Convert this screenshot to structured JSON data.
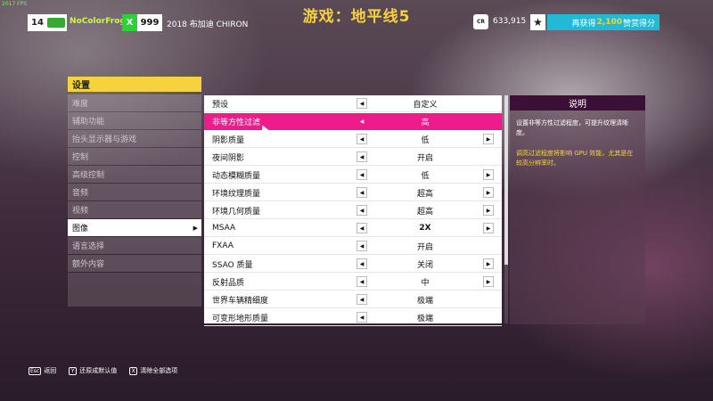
{
  "fps_text": "2017 FPS",
  "top": {
    "level": "14",
    "player_name": "NoColorFrog",
    "x_badge": "X",
    "pi": "999",
    "car_name": "2018 布加迪 CHIRON",
    "game_title": "游戏：地平线5",
    "cr_label": "CR",
    "credits": "633,915",
    "star_icon": "★",
    "xp_prefix": "再获得",
    "xp_value": "2,100",
    "xp_suffix": "赞赏得分"
  },
  "sidebar": {
    "header": "设置",
    "items": [
      {
        "label": "难度"
      },
      {
        "label": "辅助功能"
      },
      {
        "label": "抬头显示器与游戏"
      },
      {
        "label": "控制"
      },
      {
        "label": "高级控制"
      },
      {
        "label": "音频"
      },
      {
        "label": "视频"
      },
      {
        "label": "图像"
      },
      {
        "label": "语言选择"
      },
      {
        "label": "额外内容"
      }
    ],
    "active_arrow": "▶"
  },
  "settings": [
    {
      "label": "预设",
      "value": "自定义",
      "left": "◀",
      "right": ""
    },
    {
      "label": "非等方性过滤",
      "value": "高",
      "left": "◀",
      "right": ""
    },
    {
      "label": "阴影质量",
      "value": "低",
      "left": "◀",
      "right": "▶"
    },
    {
      "label": "夜间阴影",
      "value": "开启",
      "left": "◀",
      "right": ""
    },
    {
      "label": "动态模糊质量",
      "value": "低",
      "left": "◀",
      "right": "▶"
    },
    {
      "label": "环境纹理质量",
      "value": "超高",
      "left": "◀",
      "right": "▶"
    },
    {
      "label": "环境几何质量",
      "value": "超高",
      "left": "◀",
      "right": "▶"
    },
    {
      "label": "MSAA",
      "value": "2X",
      "left": "◀",
      "right": "▶"
    },
    {
      "label": "FXAA",
      "value": "开启",
      "left": "◀",
      "right": ""
    },
    {
      "label": "SSAO 质量",
      "value": "关闭",
      "left": "◀",
      "right": "▶"
    },
    {
      "label": "反射品质",
      "value": "中",
      "left": "◀",
      "right": "▶"
    },
    {
      "label": "世界车辆精细度",
      "value": "极端",
      "left": "◀",
      "right": ""
    },
    {
      "label": "可变形地形质量",
      "value": "极端",
      "left": "◀",
      "right": ""
    }
  ],
  "description": {
    "title": "说明",
    "text1": "设置非等方性过滤程度，可提升纹理清晰度。",
    "text2": "调高过滤程度将影响 GPU 效能，尤其是在较高分辨率时。"
  },
  "footer": {
    "back_key": "Esc",
    "back_label": "返回",
    "reset_key": "Y",
    "reset_label": "还原成默认值",
    "clear_key": "X",
    "clear_label": "清除全部选项"
  },
  "colors": {
    "accent_yellow": "#f7d23a",
    "selection_pink": "#ee1b8b",
    "xp_blue": "#22b9d6",
    "desc_header": "#3b0f36"
  }
}
